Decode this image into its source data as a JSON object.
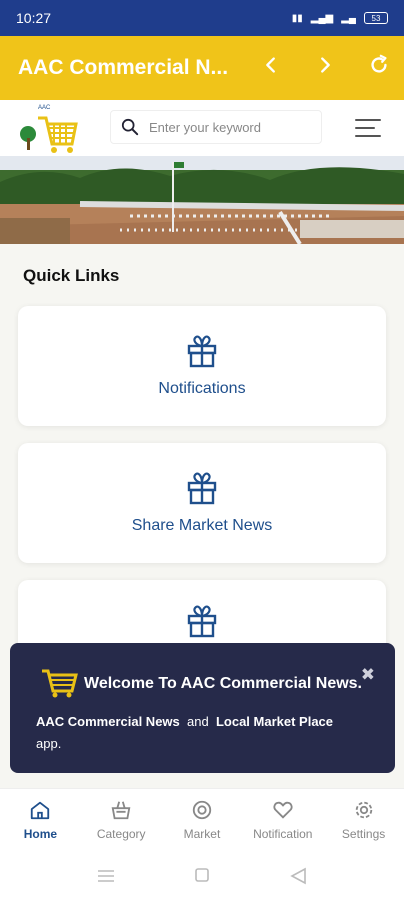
{
  "status_bar": {
    "time": "10:27",
    "battery": "53"
  },
  "app_bar": {
    "title": "AAC Commercial N...",
    "icons": [
      "chevron-left-icon",
      "chevron-right-icon",
      "refresh-icon"
    ]
  },
  "search": {
    "placeholder": "Enter your keyword"
  },
  "quick_links": {
    "title": "Quick Links",
    "items": [
      {
        "label": "Notifications",
        "icon": "gift-icon"
      },
      {
        "label": "Share Market News",
        "icon": "gift-icon"
      },
      {
        "label": "",
        "icon": "gift-icon"
      }
    ]
  },
  "toast": {
    "title": "Welcome To AAC Commercial News.",
    "body_part1": "AAC Commercial News",
    "body_and": "and",
    "body_part2": "Local Market Place",
    "body_suffix": "app."
  },
  "bottom_nav": {
    "items": [
      {
        "label": "Home",
        "icon": "home-icon"
      },
      {
        "label": "Category",
        "icon": "basket-icon"
      },
      {
        "label": "Market",
        "icon": "lifebuoy-icon"
      },
      {
        "label": "Notification",
        "icon": "heart-icon"
      },
      {
        "label": "Settings",
        "icon": "gear-icon"
      }
    ]
  },
  "colors": {
    "status_bar": "#1f3d8c",
    "app_bar": "#f0c419",
    "accent": "#1f4f8c",
    "toast_bg": "#262a4a"
  }
}
